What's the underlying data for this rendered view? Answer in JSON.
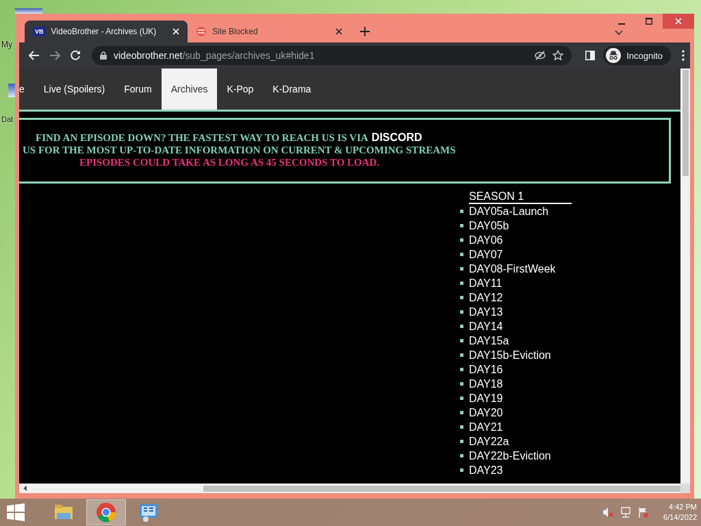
{
  "desktop": {
    "icons": [
      {
        "label": "My"
      },
      {
        "label": "Dat"
      }
    ]
  },
  "browser": {
    "tabs": [
      {
        "title": "VideoBrother - Archives (UK)",
        "favicon": "VB",
        "selected": true
      },
      {
        "title": "Site Blocked",
        "selected": false
      }
    ],
    "address": {
      "domain": "videobrother.net",
      "path": "/sub_pages/archives_uk#hide1"
    },
    "profile": "Incognito"
  },
  "page": {
    "nav": [
      {
        "label": "e",
        "selected": false
      },
      {
        "label": "Live (Spoilers)",
        "selected": false
      },
      {
        "label": "Forum",
        "selected": false
      },
      {
        "label": "Archives",
        "selected": true
      },
      {
        "label": "K-Pop",
        "selected": false
      },
      {
        "label": "K-Drama",
        "selected": false
      }
    ],
    "banner": [
      {
        "text": "FIND AN EPISODE DOWN? THE FASTEST WAY TO REACH US IS VIA",
        "link": "DISCORD",
        "color": "#7fcfb5"
      },
      {
        "text": "US FOR THE MOST UP-TO-DATE INFORMATION ON CURRENT & UPCOMING STREAMS",
        "color": "#7fcfb5"
      },
      {
        "text": "EPISODES COULD TAKE AS LONG AS 45 SECONDS TO LOAD.",
        "color": "#e8307c"
      }
    ],
    "season": {
      "title": "SEASON 1",
      "episodes": [
        "DAY05a-Launch",
        "DAY05b",
        "DAY06",
        "DAY07",
        "DAY08-FirstWeek",
        "DAY11",
        "DAY12",
        "DAY13",
        "DAY14",
        "DAY15a",
        "DAY15b-Eviction",
        "DAY16",
        "DAY18",
        "DAY19",
        "DAY20",
        "DAY21",
        "DAY22a",
        "DAY22b-Eviction",
        "DAY23"
      ]
    }
  },
  "taskbar": {
    "apps": [
      {
        "kind": "explorer",
        "selected": false
      },
      {
        "kind": "chrome",
        "selected": true
      },
      {
        "kind": "control-panel",
        "selected": false
      }
    ],
    "clock": {
      "time": "4:42 PM",
      "date": "6/14/2022"
    }
  }
}
